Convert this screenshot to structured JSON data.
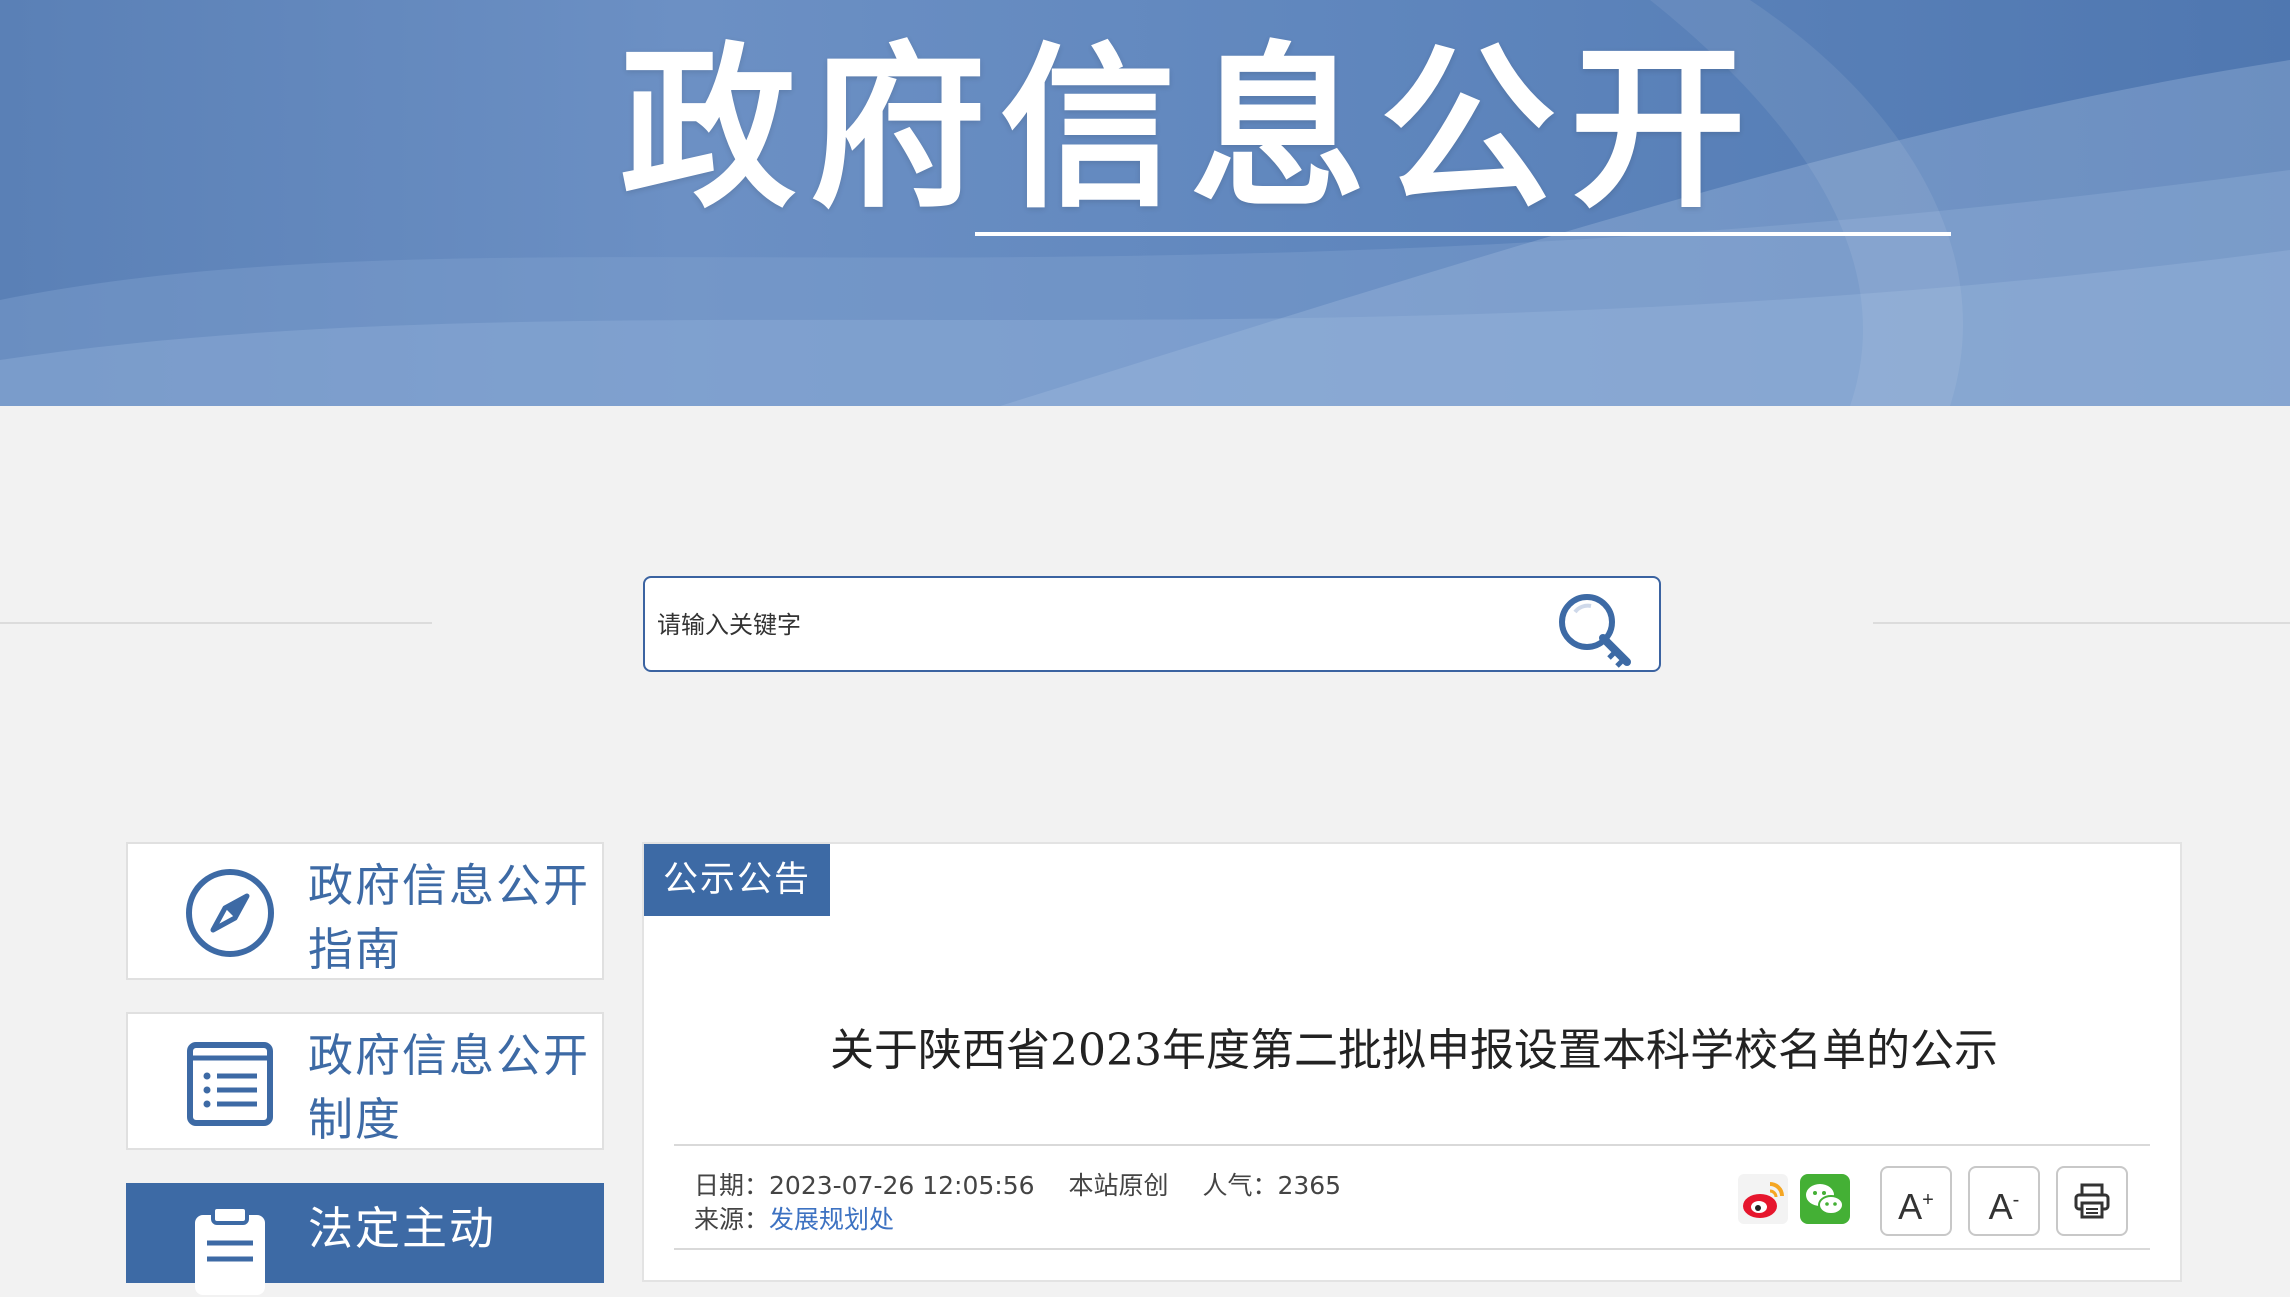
{
  "banner": {
    "title": "政府信息公开"
  },
  "search": {
    "placeholder": "请输入关键字"
  },
  "sidebar": {
    "items": [
      {
        "label": "政府信息公开指南",
        "icon": "compass-icon"
      },
      {
        "label": "政府信息公开制度",
        "icon": "document-list-icon"
      },
      {
        "label": "法定主动",
        "icon": "clipboard-icon"
      }
    ]
  },
  "content": {
    "tab": "公示公告",
    "title": "关于陕西省2023年度第二批拟申报设置本科学校名单的公示",
    "meta": {
      "date_label": "日期：",
      "date": "2023-07-26 12:05:56",
      "origin": "本站原创",
      "views_label": "人气：",
      "views": "2365",
      "source_label": "来源：",
      "source": "发展规划处"
    },
    "tools": {
      "font_increase": "A",
      "font_increase_sup": "+",
      "font_decrease": "A",
      "font_decrease_sup": "-"
    }
  },
  "colors": {
    "accent": "#3d6aa5",
    "link": "#3d72c2",
    "banner": "#5a80b6"
  }
}
